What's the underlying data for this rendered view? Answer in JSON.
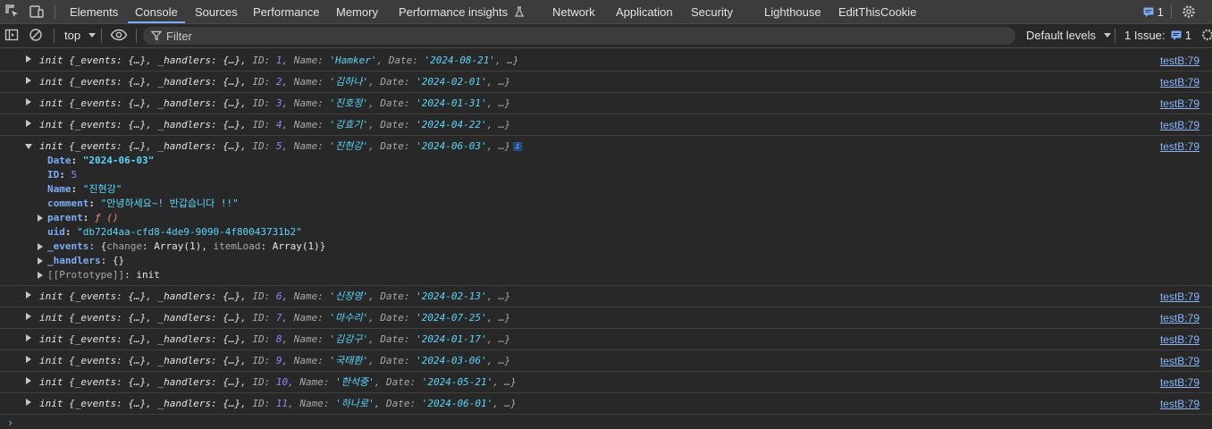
{
  "tabs": [
    "Elements",
    "Console",
    "Sources",
    "Performance",
    "Memory",
    "Performance insights",
    "Network",
    "Application",
    "Security",
    "Lighthouse",
    "EditThisCookie"
  ],
  "active_tab": "Console",
  "messages_count": "1",
  "toolbar": {
    "context": "top",
    "filter_placeholder": "Filter",
    "levels": "Default levels",
    "issues_label": "1 Issue:",
    "issues_count": "1"
  },
  "source_link": "testB:79",
  "rows": [
    {
      "id": "1",
      "name": "'Hamker'",
      "date": "'2024-08-21'"
    },
    {
      "id": "2",
      "name": "'김하나'",
      "date": "'2024-02-01'"
    },
    {
      "id": "3",
      "name": "'진호정'",
      "date": "'2024-01-31'"
    },
    {
      "id": "4",
      "name": "'강효기'",
      "date": "'2024-04-22'"
    },
    {
      "id": "5",
      "name": "'진현강'",
      "date": "'2024-06-03'"
    },
    {
      "id": "6",
      "name": "'신장영'",
      "date": "'2024-02-13'"
    },
    {
      "id": "7",
      "name": "'마수리'",
      "date": "'2024-07-25'"
    },
    {
      "id": "8",
      "name": "'김강구'",
      "date": "'2024-01-17'"
    },
    {
      "id": "9",
      "name": "'국태환'",
      "date": "'2024-03-06'"
    },
    {
      "id": "10",
      "name": "'한석중'",
      "date": "'2024-05-21'"
    },
    {
      "id": "11",
      "name": "'하나로'",
      "date": "'2024-06-01'"
    }
  ],
  "row_text": {
    "prefix": "init {_events: {…}, _handlers: {…}, ",
    "id_key": "ID: ",
    "name_key": ", Name: ",
    "date_key": ", Date: ",
    "suffix": ", …}",
    "info": "i"
  },
  "expanded": {
    "date_key": "Date",
    "date_val": "\"2024-06-03\"",
    "id_key": "ID",
    "id_val": "5",
    "name_key": "Name",
    "name_val": "\"진현강\"",
    "comment_key": "comment",
    "comment_val": "\"안녕하세요~! 반갑습니다 !!\"",
    "parent_key": "parent",
    "parent_val": "ƒ ()",
    "uid_key": "uid",
    "uid_val": "\"db72d4aa-cfd8-4de9-9090-4f80043731b2\"",
    "events_key": "_events",
    "events_val_open": "{",
    "events_change": "change",
    "events_change_val": "Array(1)",
    "events_item": "itemLoad",
    "events_item_val": "Array(1)",
    "events_val_close": "}",
    "handlers_key": "_handlers",
    "handlers_val": "{}",
    "proto_key": "[[Prototype]]",
    "proto_val": "init"
  },
  "prompt": "›"
}
